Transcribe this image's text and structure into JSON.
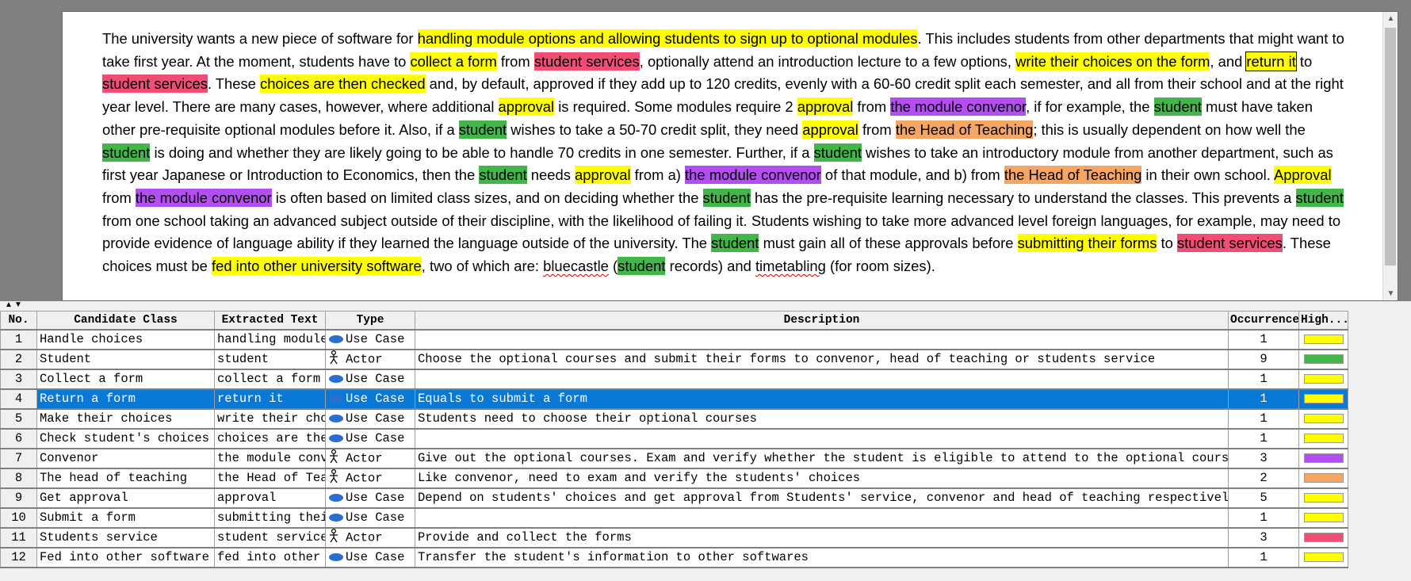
{
  "document": {
    "segments": [
      {
        "t": "The university wants a new piece of software for "
      },
      {
        "t": "handling module options and allowing students to sign up to optional modules",
        "c": "yellow"
      },
      {
        "t": ". This includes students from other departments that might want to take first year. At the moment, students have to "
      },
      {
        "t": "collect a form",
        "c": "yellow"
      },
      {
        "t": " from "
      },
      {
        "t": "student services",
        "c": "red"
      },
      {
        "t": ", optionally attend an introduction lecture to a few options, "
      },
      {
        "t": "write their choices on the form",
        "c": "yellow"
      },
      {
        "t": ", and "
      },
      {
        "t": "return it",
        "c": "yellow",
        "boxed": true
      },
      {
        "t": " to "
      },
      {
        "t": "student services",
        "c": "red"
      },
      {
        "t": ". These "
      },
      {
        "t": "choices are then checked",
        "c": "yellow"
      },
      {
        "t": " and, by default, approved if they add up to 120 credits, evenly with a 60-60 credit split each semester, and all from their school and at the right year level. There are many cases, however, where additional "
      },
      {
        "t": "approval",
        "c": "yellow"
      },
      {
        "t": " is required. Some modules require 2 "
      },
      {
        "t": "approval",
        "c": "yellow"
      },
      {
        "t": " from "
      },
      {
        "t": "the module convenor",
        "c": "purple"
      },
      {
        "t": ", if for example, the "
      },
      {
        "t": "student",
        "c": "green"
      },
      {
        "t": " must have taken other pre-requisite optional modules before it. Also, if a "
      },
      {
        "t": "student",
        "c": "green"
      },
      {
        "t": " wishes to take a 50-70 credit split, they need "
      },
      {
        "t": "approval",
        "c": "yellow"
      },
      {
        "t": " from "
      },
      {
        "t": "the Head of Teaching",
        "c": "orange"
      },
      {
        "t": "; this is usually dependent on how well the "
      },
      {
        "t": "student",
        "c": "green"
      },
      {
        "t": " is doing and whether they are likely going to be able to handle 70 credits in one semester. Further, if a "
      },
      {
        "t": "student",
        "c": "green"
      },
      {
        "t": " wishes to take an introductory module from another department, such as first year Japanese or Introduction to Economics, then the "
      },
      {
        "t": "student",
        "c": "green"
      },
      {
        "t": " needs "
      },
      {
        "t": "approval",
        "c": "yellow"
      },
      {
        "t": " from a) "
      },
      {
        "t": "the module convenor",
        "c": "purple"
      },
      {
        "t": " of that module, and b) from "
      },
      {
        "t": "the Head of Teaching",
        "c": "orange"
      },
      {
        "t": " in their own school. "
      },
      {
        "t": "Approval",
        "c": "yellow"
      },
      {
        "t": " from "
      },
      {
        "t": "the module convenor",
        "c": "purple"
      },
      {
        "t": " is often based on limited class sizes, and on deciding whether the "
      },
      {
        "t": "student",
        "c": "green"
      },
      {
        "t": " has the pre-requisite learning necessary to understand the classes. This prevents a "
      },
      {
        "t": "student",
        "c": "green"
      },
      {
        "t": " from one school taking an advanced subject outside of their discipline, with the likelihood of failing it. Students wishing to take more advanced level foreign languages, for example, may need to provide evidence of language ability if they learned the language outside of the university. The "
      },
      {
        "t": "student",
        "c": "green"
      },
      {
        "t": " must gain all of these approvals before "
      },
      {
        "t": "submitting their forms",
        "c": "yellow"
      },
      {
        "t": " to "
      },
      {
        "t": "student services",
        "c": "red"
      },
      {
        "t": ". These choices must be "
      },
      {
        "t": "fed into other university software",
        "c": "yellow"
      },
      {
        "t": ", two of which are: "
      },
      {
        "t": "bluecastle",
        "squig": true
      },
      {
        "t": " ("
      },
      {
        "t": "student",
        "c": "green"
      },
      {
        "t": " records) and "
      },
      {
        "t": "timetabling",
        "squig": true
      },
      {
        "t": " (for room sizes)."
      }
    ]
  },
  "table": {
    "headers": [
      "No.",
      "Candidate Class",
      "Extracted Text",
      "Type",
      "Description",
      "Occurrence",
      "High..."
    ],
    "rows": [
      {
        "no": "1",
        "cls": "Handle choices",
        "ext": "handling module options",
        "type": "Use Case",
        "desc": "",
        "occ": "1",
        "color": "#ffff00"
      },
      {
        "no": "2",
        "cls": "Student",
        "ext": "student",
        "type": "Actor",
        "desc": "Choose the optional courses and submit their forms to convenor, head of teaching or students service",
        "occ": "9",
        "color": "#43b649"
      },
      {
        "no": "3",
        "cls": "Collect a form",
        "ext": "collect a form",
        "type": "Use Case",
        "desc": "",
        "occ": "1",
        "color": "#ffff00"
      },
      {
        "no": "4",
        "cls": "Return a form",
        "ext": "return it",
        "type": "Use Case",
        "desc": "Equals to submit a form",
        "occ": "1",
        "color": "#ffff00",
        "selected": true
      },
      {
        "no": "5",
        "cls": "Make their choices",
        "ext": "write their choices",
        "type": "Use Case",
        "desc": "Students need to choose their optional courses",
        "occ": "1",
        "color": "#ffff00"
      },
      {
        "no": "6",
        "cls": "Check student's choices",
        "ext": "choices are then checked",
        "type": "Use Case",
        "desc": "",
        "occ": "1",
        "color": "#ffff00"
      },
      {
        "no": "7",
        "cls": "Convenor",
        "ext": "the module convenor",
        "type": "Actor",
        "desc": "Give out the optional courses. Exam and verify whether the student is eligible to attend to the optional courses.",
        "occ": "3",
        "color": "#b44ef2"
      },
      {
        "no": "8",
        "cls": "The head of teaching",
        "ext": "the Head of Teaching",
        "type": "Actor",
        "desc": "Like convenor, need to exam and verify the students' choices",
        "occ": "2",
        "color": "#f5a663"
      },
      {
        "no": "9",
        "cls": "Get approval",
        "ext": "approval",
        "type": "Use Case",
        "desc": "Depend on students' choices and get approval from Students' service, convenor and head of teaching respectively",
        "occ": "5",
        "color": "#ffff00"
      },
      {
        "no": "10",
        "cls": "Submit a form",
        "ext": "submitting their forms",
        "type": "Use Case",
        "desc": "",
        "occ": "1",
        "color": "#ffff00"
      },
      {
        "no": "11",
        "cls": "Students service",
        "ext": "student services",
        "type": "Actor",
        "desc": "Provide and collect the forms",
        "occ": "3",
        "color": "#f24d75"
      },
      {
        "no": "12",
        "cls": "Fed into other software",
        "ext": "fed into other university software",
        "type": "Use Case",
        "desc": "Transfer the student's information to other softwares",
        "occ": "1",
        "color": "#ffff00"
      }
    ]
  },
  "icons": {
    "use_case": "ellipse-icon",
    "actor": "stick-figure-icon"
  }
}
